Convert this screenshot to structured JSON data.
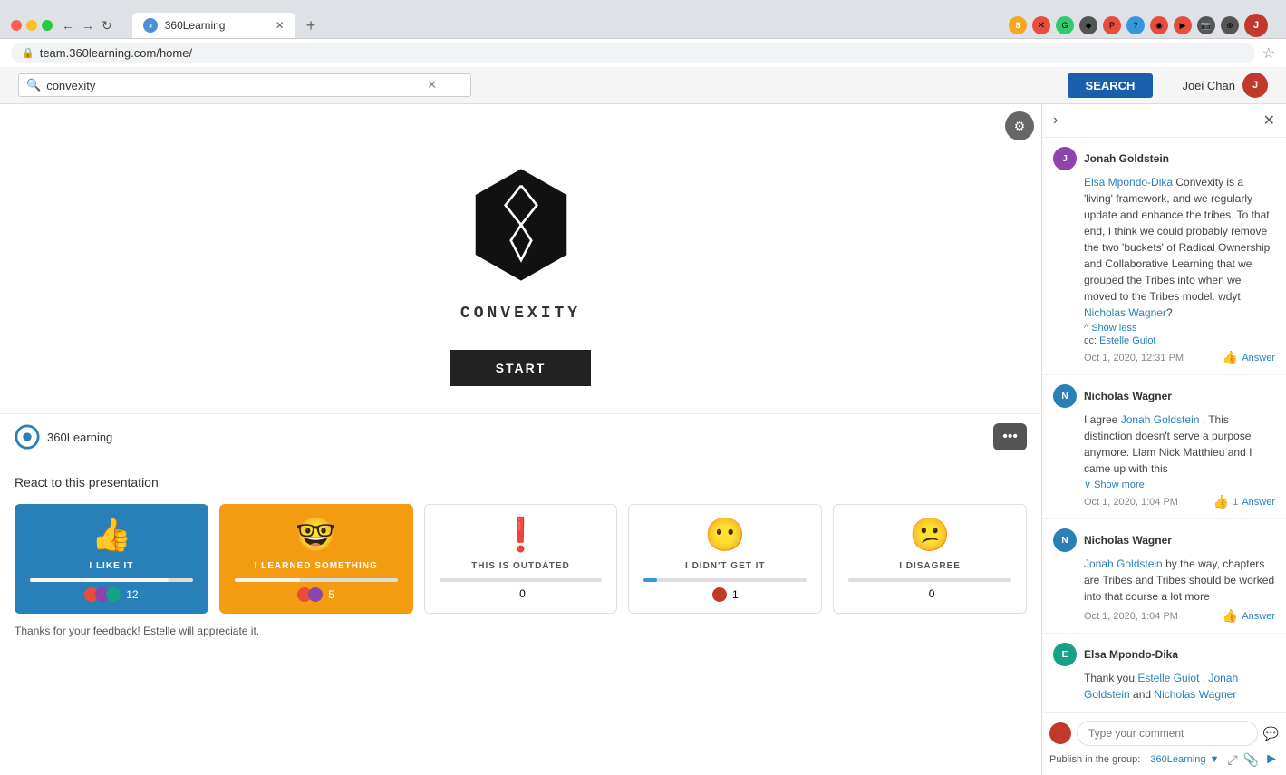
{
  "browser": {
    "tab_title": "360Learning",
    "url": "team.360learning.com/home/",
    "favicon": "360"
  },
  "topbar": {
    "search_placeholder": "convexity",
    "search_button": "SEARCH",
    "user_name": "Joei Chan"
  },
  "course": {
    "title": "CONVEXITY",
    "start_button": "START",
    "brand": "360Learning"
  },
  "reactions": {
    "title": "React to this presentation",
    "items": [
      {
        "id": "like",
        "emoji": "👍",
        "label": "I LIKE IT",
        "count": 12,
        "active": "blue",
        "bar_width": "85%"
      },
      {
        "id": "learned",
        "emoji": "🤓",
        "label": "I LEARNED SOMETHING",
        "count": 5,
        "active": "orange",
        "bar_width": "40%"
      },
      {
        "id": "outdated",
        "emoji": "❗",
        "label": "THIS IS OUTDATED",
        "count": 0,
        "active": "none",
        "bar_width": "0%"
      },
      {
        "id": "didnt-get",
        "emoji": "😶",
        "label": "I DIDN'T GET IT",
        "count": 1,
        "active": "none",
        "bar_width": "8%"
      },
      {
        "id": "disagree",
        "emoji": "😕",
        "label": "I DISAGREE",
        "count": 0,
        "active": "none",
        "bar_width": "0%"
      }
    ],
    "feedback_note": "Thanks for your feedback! Estelle will appreciate it."
  },
  "sidebar": {
    "comments": [
      {
        "id": "c1",
        "author": "Jonah Goldstein",
        "avatar_class": "av-jonah",
        "body_prefix": "Elsa Mpondo-Dika",
        "body": " Convexity is a 'living' framework, and we regularly update and enhance the tribes. To that end, I think we could probably remove the two 'buckets' of Radical Ownership and Collaborative Learning that we grouped the Tribes into when we moved to the Tribes model. wdyt ",
        "mention": "Nicholas Wagner",
        "mention_suffix": "?",
        "cc": "Estelle Guiot",
        "show_label": "Show less",
        "time": "Oct 1, 2020, 12:31 PM",
        "likes": 0,
        "answer": "Answer"
      },
      {
        "id": "c2",
        "author": "Nicholas Wagner",
        "avatar_class": "av-nicholas",
        "body_prefix": "Jonah Goldstein",
        "body": " . This distinction doesn't serve a purpose anymore. Llam Nick Matthieu and I came up with this",
        "show_more": "Show more",
        "time": "Oct 1, 2020, 1:04 PM",
        "likes": 1,
        "answer": "Answer"
      },
      {
        "id": "c3",
        "author": "Nicholas Wagner",
        "avatar_class": "av-nicholas",
        "body_prefix": "Jonah Goldstein",
        "body": " by the way, chapters are Tribes and Tribes should be worked into that course a lot more",
        "time": "Oct 1, 2020, 1:04 PM",
        "likes": 0,
        "answer": "Answer"
      },
      {
        "id": "c4",
        "author": "Elsa Mpondo-Dika",
        "avatar_class": "av-elsa",
        "body_prefix": "Thank you ",
        "mention1": "Estelle Guiot",
        "sep": " ,\n",
        "mention2": "Jonah Goldstein",
        "conj": " and ",
        "mention3": "Nicholas Wagner",
        "body": ""
      }
    ],
    "input_placeholder": "Type your comment",
    "publish_prefix": "Publish in the group:",
    "publish_group": "360Learning"
  }
}
